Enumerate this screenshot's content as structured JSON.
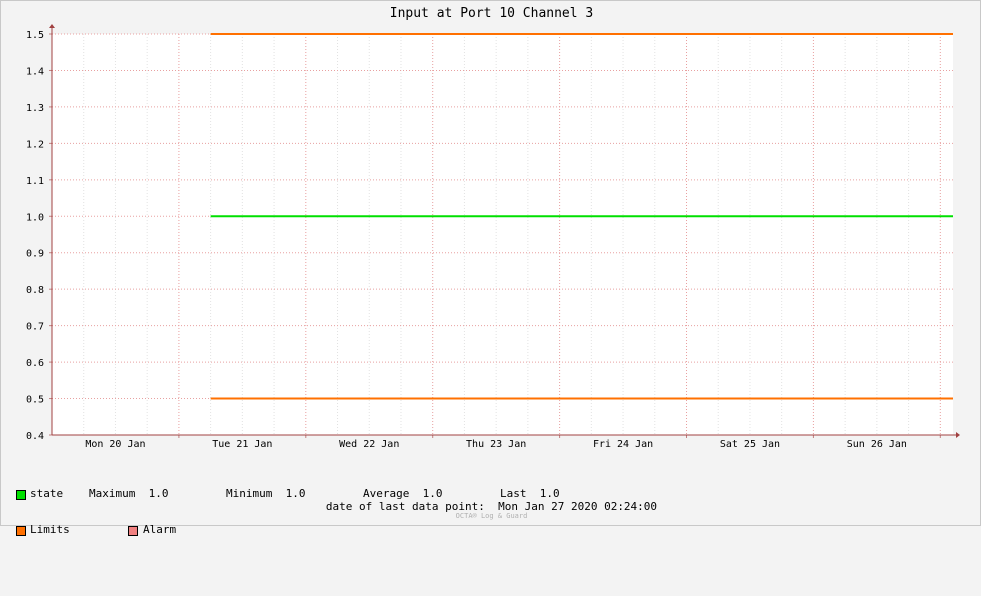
{
  "chart_data": {
    "type": "line",
    "title": "Input at Port 10 Channel 3",
    "xlabel": "",
    "ylabel": "",
    "ylim": [
      0.4,
      1.5
    ],
    "y_ticks": [
      "0.4",
      "0.5",
      "0.6",
      "0.7",
      "0.8",
      "0.9",
      "1.0",
      "1.1",
      "1.2",
      "1.3",
      "1.4",
      "1.5"
    ],
    "x_range": [
      "2020-01-20 00:00",
      "2020-01-27 02:24"
    ],
    "x_ticks": [
      {
        "label": "Mon 20 Jan",
        "at": "2020-01-20 12:00"
      },
      {
        "label": "Tue 21 Jan",
        "at": "2020-01-21 12:00"
      },
      {
        "label": "Wed 22 Jan",
        "at": "2020-01-22 12:00"
      },
      {
        "label": "Thu 23 Jan",
        "at": "2020-01-23 12:00"
      },
      {
        "label": "Fri 24 Jan",
        "at": "2020-01-24 12:00"
      },
      {
        "label": "Sat 25 Jan",
        "at": "2020-01-25 12:00"
      },
      {
        "label": "Sun 26 Jan",
        "at": "2020-01-26 12:00"
      }
    ],
    "grid": true,
    "legend_position": "bottom-left",
    "series": [
      {
        "name": "state",
        "color": "#00e000",
        "x": [
          "2020-01-21 06:00",
          "2020-01-27 02:24"
        ],
        "y": [
          1.0,
          1.0
        ]
      },
      {
        "name": "Limits",
        "color": "#ff7000",
        "x": [
          "2020-01-21 06:00",
          "2020-01-27 02:24"
        ],
        "y": [
          1.5,
          1.5
        ]
      },
      {
        "name": "Limits",
        "color": "#ff7000",
        "x": [
          "2020-01-21 06:00",
          "2020-01-27 02:24"
        ],
        "y": [
          0.5,
          0.5
        ]
      }
    ]
  },
  "legend": {
    "state": {
      "label": "state",
      "color": "#00e000"
    },
    "stats": {
      "maximum": "Maximum  1.0",
      "minimum": "Minimum  1.0",
      "average": "Average  1.0",
      "last": "Last  1.0"
    },
    "limits": {
      "label": "Limits",
      "color": "#ff7000"
    },
    "alarm": {
      "label": "Alarm",
      "color": "#f08080"
    }
  },
  "last_data_point": "date of last data point:  Mon Jan 27 2020 02:24:00",
  "footer": "OCTA® Log & Guard"
}
